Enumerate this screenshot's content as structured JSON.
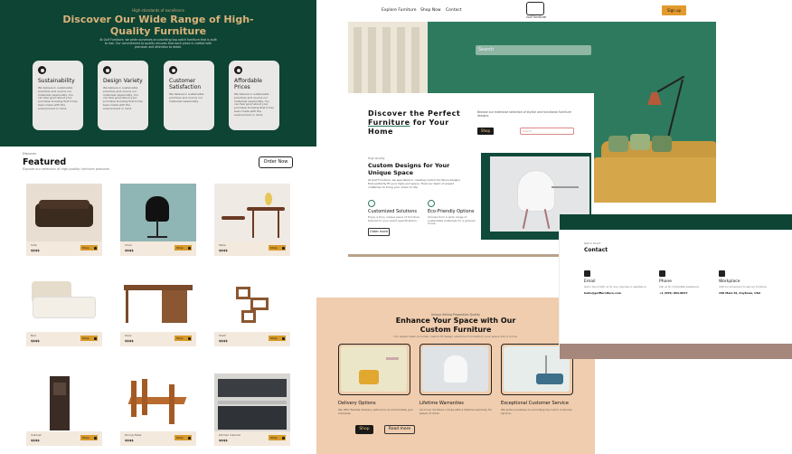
{
  "hero": {
    "kicker": "High standards of excellence",
    "title": "Discover Our Wide Range of High-Quality Furniture",
    "description": "At Gulf Furniture, we pride ourselves on providing top-notch furniture that is built to last. Our commitment to quality ensures that each piece is crafted with precision and attention to detail."
  },
  "feature_cards": [
    {
      "title": "Sustainability",
      "icon": "leaf-icon",
      "desc": "We believe in sustainable practices and source our materials responsibly. You can feel good about your purchase knowing that it has been made with the environment in mind."
    },
    {
      "title": "Design Variety",
      "icon": "palette-icon",
      "desc": "We believe in sustainable practices and source our materials responsibly. You can feel good about your purchase knowing that it has been made with the environment in mind."
    },
    {
      "title": "Customer Satisfaction",
      "icon": "smile-icon",
      "desc": "We believe in sustainable practices and source our materials responsibly."
    },
    {
      "title": "Affordable Prices",
      "icon": "dollar-icon",
      "desc": "We believe in sustainable practices and source our materials responsibly. You can feel good about your purchase knowing that it has been made with the environment in mind."
    }
  ],
  "featured": {
    "kicker": "Discover",
    "title": "Featured",
    "description": "Explore our selection of high-quality furniture products",
    "order_button": "Order Now",
    "products": [
      {
        "name": "Sofa",
        "price": "$$$$",
        "shop": "Shop"
      },
      {
        "name": "Chair",
        "price": "$$$$",
        "shop": "Shop"
      },
      {
        "name": "Table",
        "price": "$$$$",
        "shop": "Shop"
      },
      {
        "name": "Bed",
        "price": "$$$$",
        "shop": "Shop"
      },
      {
        "name": "Desk",
        "price": "$$$$",
        "shop": "Shop"
      },
      {
        "name": "Shelf",
        "price": "$$$$",
        "shop": "Shop"
      },
      {
        "name": "Cabinet",
        "price": "$$$$",
        "shop": "Shop"
      },
      {
        "name": "Dining Table",
        "price": "$$$$",
        "shop": "Shop"
      },
      {
        "name": "Kitchen Cabinet",
        "price": "$$$$",
        "shop": "Shop"
      }
    ]
  },
  "header": {
    "nav": [
      "Explore Furniture",
      "Shop Now",
      "Contact"
    ],
    "logo_text": "Gulf Furniture",
    "signup": "Sign up",
    "search_placeholder": "Search"
  },
  "promo": {
    "title_a": "Discover the Perfect",
    "title_b": "Furniture",
    "title_c": "for Your Home",
    "description": "Browse our extensive selection of stylish and functional furniture designs.",
    "shop": "Shop",
    "input_placeholder": "Search"
  },
  "custom": {
    "kicker": "High Quality",
    "title": "Custom Designs for Your Unique Space",
    "description": "At Gulf Furniture, we specialize in creating custom furniture designs that perfectly fit your style and space. Trust our team of expert craftsmen to bring your vision to life.",
    "features": [
      {
        "title": "Customized Solutions",
        "desc": "Enjoy a truly unique piece of furniture tailored to your exact specifications."
      },
      {
        "title": "Eco-Friendly Options",
        "desc": "Choose from a wide range of sustainable materials for a greener home."
      }
    ],
    "more": "Order more"
  },
  "enhance": {
    "kicker": "Unique Selling Proposition Quality",
    "title": "Enhance Your Space with Our Custom Furniture",
    "description": "Our expert team provides custom-fit design solutions to transform your space into a home.",
    "items": [
      {
        "title": "Delivery Options",
        "desc": "We offer flexible delivery options to accommodate your schedule."
      },
      {
        "title": "Lifetime Warranties",
        "desc": "All of our furniture comes with a lifetime warranty for peace of mind."
      },
      {
        "title": "Exceptional Customer Service",
        "desc": "We pride ourselves on providing top-notch customer service."
      }
    ],
    "shop": "Shop",
    "more": "Read more"
  },
  "contact": {
    "kicker": "Get in touch",
    "title": "Contact",
    "items": [
      {
        "title": "Email",
        "icon": "mail-icon",
        "desc": "Get in touch with us for any inquiries or assistance.",
        "value": "hello@gulffurniture.com"
      },
      {
        "title": "Phone",
        "icon": "phone-icon",
        "desc": "Call us for immediate assistance.",
        "value": "+1 (555) 903-8647"
      },
      {
        "title": "Workplace",
        "icon": "location-icon",
        "desc": "Visit our showroom to see our furniture.",
        "value": "150 Main St, Anytown, USA"
      }
    ]
  }
}
